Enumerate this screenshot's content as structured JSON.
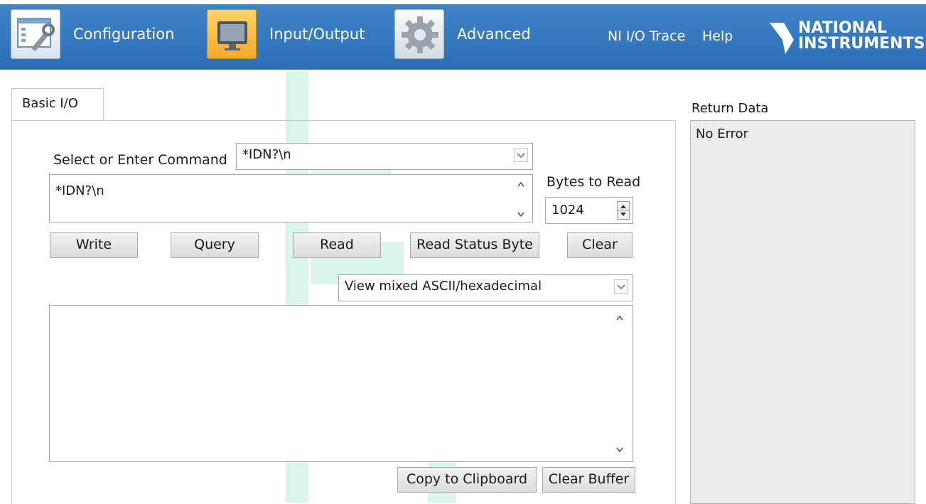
{
  "toolbar": {
    "configuration_label": "Configuration",
    "io_label": "Input/Output",
    "advanced_label": "Advanced",
    "trace_label": "NI I/O Trace",
    "help_label": "Help",
    "logo_line1": "NATIONAL",
    "logo_line2": "INSTRUMENTS",
    "icons": {
      "configuration": "wrench-window-icon",
      "io": "monitor-icon",
      "advanced": "gear-icon",
      "logo": "ni-eagle-icon"
    }
  },
  "tabs": [
    {
      "label": "Basic I/O",
      "active": true
    }
  ],
  "command": {
    "label": "Select or Enter Command",
    "selected": "*IDN?\\n",
    "text": "*IDN?\\n"
  },
  "bytes_to_read": {
    "label": "Bytes to Read",
    "value": "1024"
  },
  "actions": {
    "write": "Write",
    "query": "Query",
    "read": "Read",
    "read_status_byte": "Read Status Byte",
    "clear": "Clear"
  },
  "view_mode": {
    "selected": "View mixed ASCII/hexadecimal"
  },
  "output": {
    "text": ""
  },
  "buffer_actions": {
    "copy": "Copy to Clipboard",
    "clear_buffer": "Clear Buffer"
  },
  "return_data": {
    "label": "Return Data",
    "text": "No Error"
  },
  "colors": {
    "toolbar_blue": "#2d6eb4",
    "io_highlight": "#f3a92a",
    "watermark": "#bfeee0"
  }
}
